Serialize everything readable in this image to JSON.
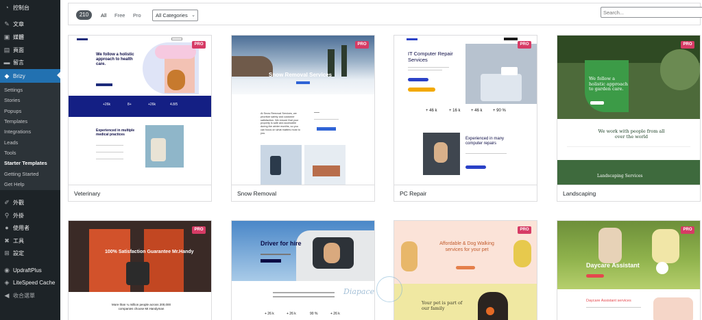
{
  "sidebar": {
    "items": [
      {
        "label": "控制台",
        "icon": "dashboard-icon"
      },
      {
        "label": "文章",
        "icon": "pin-icon"
      },
      {
        "label": "媒體",
        "icon": "media-icon"
      },
      {
        "label": "頁面",
        "icon": "page-icon"
      },
      {
        "label": "留言",
        "icon": "comment-icon"
      },
      {
        "label": "Brizy",
        "icon": "brizy-icon"
      },
      {
        "label": "外觀",
        "icon": "brush-icon"
      },
      {
        "label": "外掛",
        "icon": "plugin-icon"
      },
      {
        "label": "使用者",
        "icon": "user-icon"
      },
      {
        "label": "工具",
        "icon": "wrench-icon"
      },
      {
        "label": "設定",
        "icon": "settings-icon"
      },
      {
        "label": "UpdraftPlus",
        "icon": "updraft-icon"
      },
      {
        "label": "LiteSpeed Cache",
        "icon": "litespeed-icon"
      },
      {
        "label": "收合選單",
        "icon": "collapse-icon"
      }
    ],
    "submenu": [
      "Settings",
      "Stories",
      "Popups",
      "Templates",
      "Integrations",
      "Leads",
      "Tools",
      "Starter Templates",
      "Getting Started",
      "Get Help"
    ]
  },
  "filters": {
    "count": "210",
    "tabs": [
      "All",
      "Free",
      "Pro"
    ],
    "category": "All Categories",
    "search_placeholder": "Search..."
  },
  "badge_label": "PRO",
  "cards": [
    {
      "name": "Veterinary",
      "pro": true
    },
    {
      "name": "Snow Removal",
      "pro": true
    },
    {
      "name": "PC Repair",
      "pro": true
    },
    {
      "name": "Landscaping",
      "pro": true
    },
    {
      "name": "",
      "pro": true
    },
    {
      "name": "",
      "pro": true
    },
    {
      "name": "",
      "pro": true
    },
    {
      "name": "",
      "pro": true
    }
  ],
  "previews": {
    "vet": {
      "headline": "We follow a holistic approach to health care.",
      "stats": [
        "+26k",
        "8+",
        "+26k",
        "4.8/5"
      ],
      "section": "Experienced in multiple medical practices"
    },
    "snow": {
      "headline": "Snow Removal Services",
      "body": "At Snow Removal Services, we prioritize safety and customer satisfaction. We ensure that your property is safe and accessible during the winter months, so you can focus on what matters most to you."
    },
    "pc": {
      "headline": "IT Computer Repair Services",
      "stats": [
        "+ 46 k",
        "+ 16 k",
        "+ 46 k",
        "+ 90 %"
      ],
      "section": "Experienced in many computer repairs"
    },
    "land": {
      "headline": "We follow a holistic approach to garden care.",
      "section": "We work with people from all over the world",
      "footer": "Landscaping Services"
    },
    "handy": {
      "headline": "100% Satisfaction Guarantee Mr.Handy",
      "body": "More than ¼ million people across 200,000 companies choose Mr.Handyman"
    },
    "driver": {
      "headline": "Driver for hire",
      "stats": [
        "+ 26 k",
        "+ 26 k",
        "90 %",
        "+ 26 k"
      ]
    },
    "dog": {
      "headline": "Affordable & Dog Walking services for your pet",
      "section": "Your pet is part of our family"
    },
    "daycare": {
      "headline": "Daycare Assistant",
      "section": "Daycare Assistant services"
    }
  },
  "colors": {
    "sidebar_bg": "#1d2327",
    "accent": "#2271b1",
    "pro_badge": "#d63b65"
  }
}
